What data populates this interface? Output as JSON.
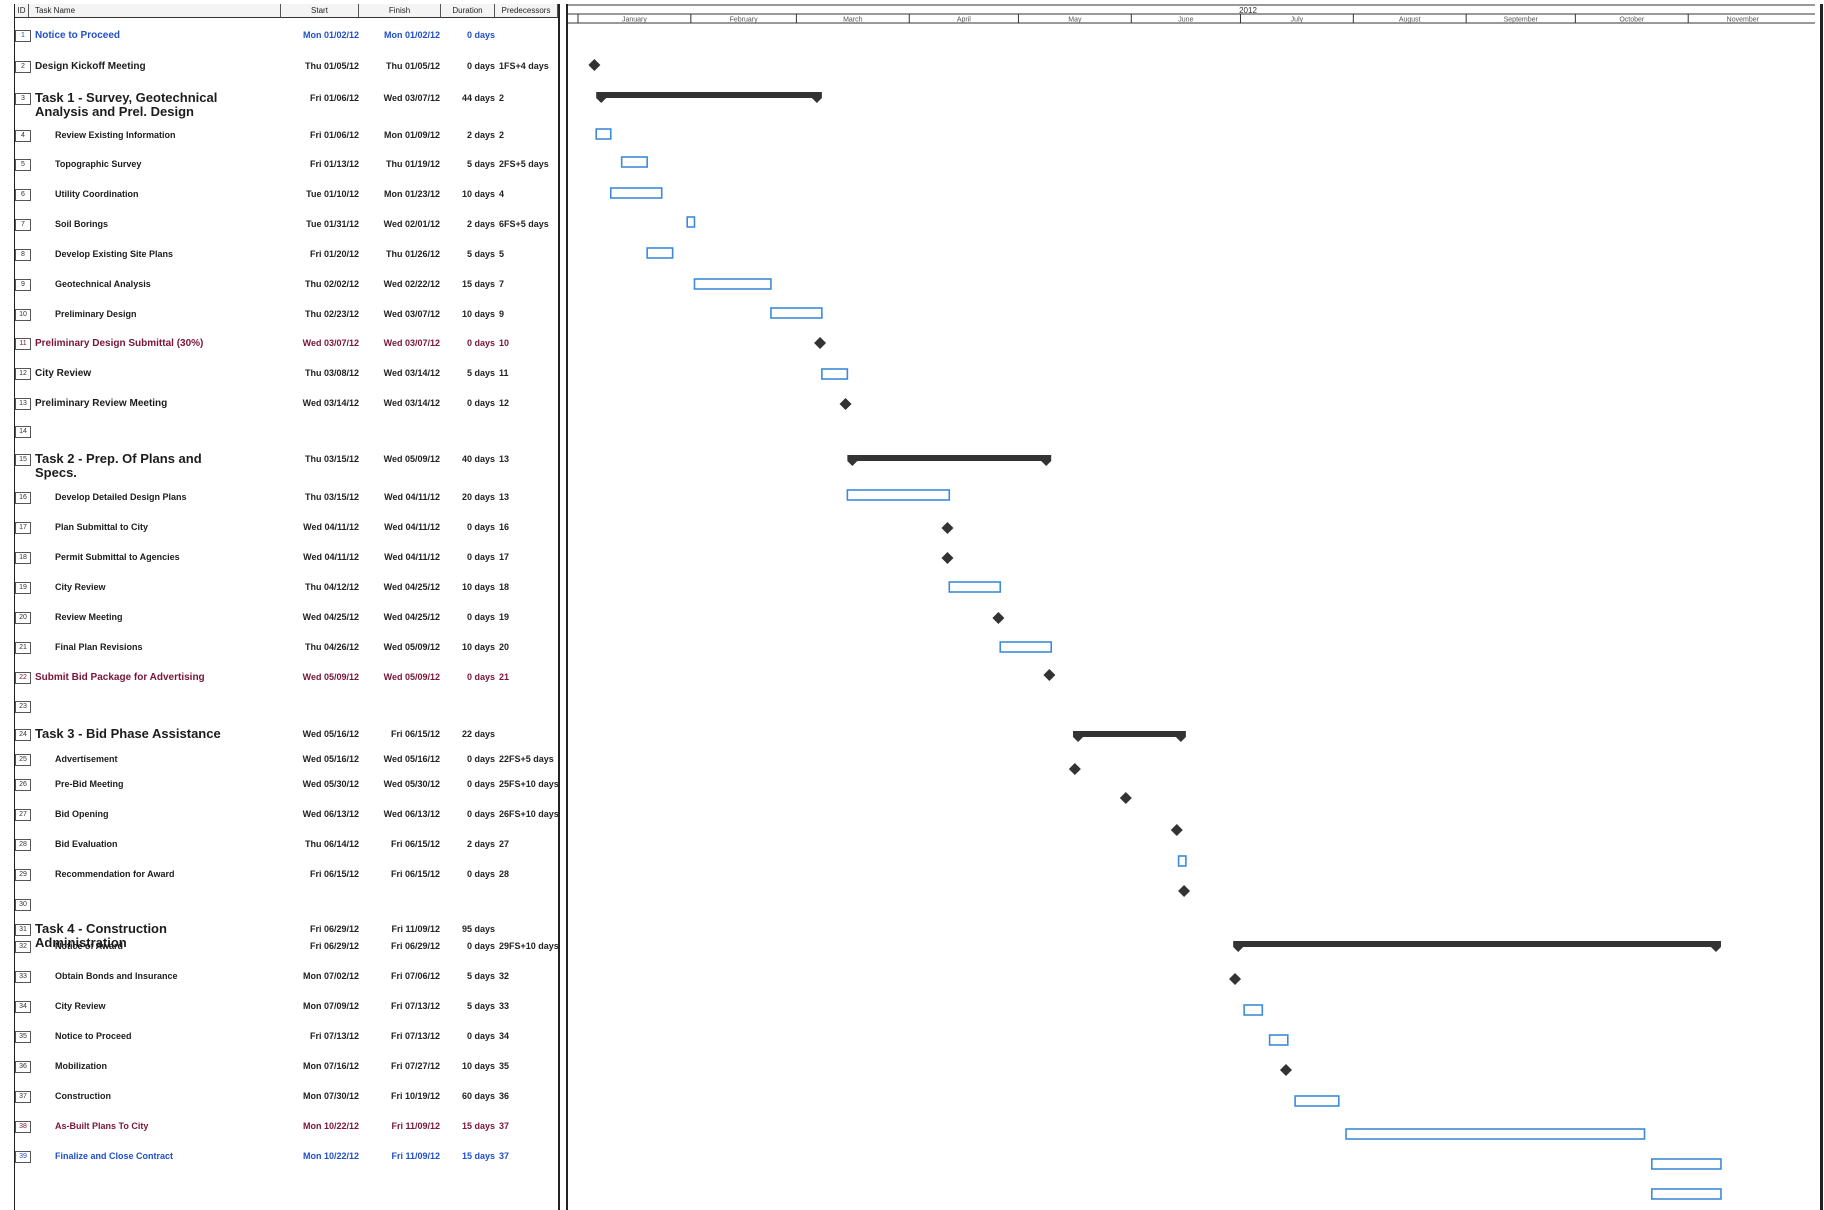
{
  "columns": {
    "id": "ID",
    "name": "Task Name",
    "start": "Start",
    "finish": "Finish",
    "duration": "Duration",
    "predecessors": "Predecessors"
  },
  "timeline": {
    "year": "2012",
    "months": [
      "January",
      "February",
      "March",
      "April",
      "May",
      "June",
      "July",
      "August",
      "September",
      "October",
      "November"
    ]
  },
  "colors": {
    "bar": "#3d8bd8",
    "summary": "#333333",
    "milestone": "#333333",
    "milestone_text": "#1f4fc9",
    "deliverable_text": "#7a1535"
  },
  "tasks": [
    {
      "id": "1",
      "name": "Notice to Proceed",
      "start": "Mon 01/02/12",
      "finish": "Mon 01/02/12",
      "duration": "0 days",
      "pred": "",
      "kind": "top",
      "color": "blue",
      "s": "2012-01-02",
      "f": "2012-01-02",
      "type": "none"
    },
    {
      "id": "2",
      "name": "Design Kickoff Meeting",
      "start": "Thu 01/05/12",
      "finish": "Thu 01/05/12",
      "duration": "0 days",
      "pred": "1FS+4 days",
      "kind": "top",
      "color": "",
      "s": "2012-01-05",
      "f": "2012-01-05",
      "type": "milestone"
    },
    {
      "id": "3",
      "name": "Task 1 - Survey, Geotechnical Analysis and Prel. Design",
      "start": "Fri 01/06/12",
      "finish": "Wed 03/07/12",
      "duration": "44 days",
      "pred": "2",
      "kind": "task",
      "color": "",
      "s": "2012-01-06",
      "f": "2012-03-07",
      "type": "summary"
    },
    {
      "id": "4",
      "name": "Review Existing Information",
      "start": "Fri 01/06/12",
      "finish": "Mon 01/09/12",
      "duration": "2 days",
      "pred": "2",
      "kind": "sub",
      "color": "",
      "s": "2012-01-06",
      "f": "2012-01-09",
      "type": "bar"
    },
    {
      "id": "5",
      "name": "Topographic Survey",
      "start": "Fri 01/13/12",
      "finish": "Thu 01/19/12",
      "duration": "5 days",
      "pred": "2FS+5 days",
      "kind": "sub",
      "color": "",
      "s": "2012-01-13",
      "f": "2012-01-19",
      "type": "bar"
    },
    {
      "id": "6",
      "name": "Utility Coordination",
      "start": "Tue 01/10/12",
      "finish": "Mon 01/23/12",
      "duration": "10 days",
      "pred": "4",
      "kind": "sub",
      "color": "",
      "s": "2012-01-10",
      "f": "2012-01-23",
      "type": "bar"
    },
    {
      "id": "7",
      "name": "Soil Borings",
      "start": "Tue 01/31/12",
      "finish": "Wed 02/01/12",
      "duration": "2 days",
      "pred": "6FS+5 days",
      "kind": "sub",
      "color": "",
      "s": "2012-01-31",
      "f": "2012-02-01",
      "type": "bar"
    },
    {
      "id": "8",
      "name": "Develop Existing Site Plans",
      "start": "Fri 01/20/12",
      "finish": "Thu 01/26/12",
      "duration": "5 days",
      "pred": "5",
      "kind": "sub",
      "color": "",
      "s": "2012-01-20",
      "f": "2012-01-26",
      "type": "bar"
    },
    {
      "id": "9",
      "name": "Geotechnical Analysis",
      "start": "Thu 02/02/12",
      "finish": "Wed 02/22/12",
      "duration": "15 days",
      "pred": "7",
      "kind": "sub",
      "color": "",
      "s": "2012-02-02",
      "f": "2012-02-22",
      "type": "bar"
    },
    {
      "id": "10",
      "name": "Preliminary Design",
      "start": "Thu 02/23/12",
      "finish": "Wed 03/07/12",
      "duration": "10 days",
      "pred": "9",
      "kind": "sub",
      "color": "",
      "s": "2012-02-23",
      "f": "2012-03-07",
      "type": "bar"
    },
    {
      "id": "11",
      "name": "Preliminary Design Submittal (30%)",
      "start": "Wed 03/07/12",
      "finish": "Wed 03/07/12",
      "duration": "0 days",
      "pred": "10",
      "kind": "top",
      "color": "maroon",
      "s": "2012-03-07",
      "f": "2012-03-07",
      "type": "milestone"
    },
    {
      "id": "12",
      "name": "City Review",
      "start": "Thu 03/08/12",
      "finish": "Wed 03/14/12",
      "duration": "5 days",
      "pred": "11",
      "kind": "top",
      "color": "",
      "s": "2012-03-08",
      "f": "2012-03-14",
      "type": "bar"
    },
    {
      "id": "13",
      "name": "Preliminary Review Meeting",
      "start": "Wed 03/14/12",
      "finish": "Wed 03/14/12",
      "duration": "0 days",
      "pred": "12",
      "kind": "top",
      "color": "",
      "s": "2012-03-14",
      "f": "2012-03-14",
      "type": "milestone"
    },
    {
      "id": "14",
      "name": "",
      "start": "",
      "finish": "",
      "duration": "",
      "pred": "",
      "kind": "top",
      "color": "",
      "s": "",
      "f": "",
      "type": "none"
    },
    {
      "id": "15",
      "name": "Task 2 - Prep. Of Plans and Specs.",
      "start": "Thu 03/15/12",
      "finish": "Wed 05/09/12",
      "duration": "40 days",
      "pred": "13",
      "kind": "task",
      "color": "",
      "s": "2012-03-15",
      "f": "2012-05-09",
      "type": "summary"
    },
    {
      "id": "16",
      "name": "Develop Detailed Design Plans",
      "start": "Thu 03/15/12",
      "finish": "Wed 04/11/12",
      "duration": "20 days",
      "pred": "13",
      "kind": "sub",
      "color": "",
      "s": "2012-03-15",
      "f": "2012-04-11",
      "type": "bar"
    },
    {
      "id": "17",
      "name": "Plan Submittal to City",
      "start": "Wed 04/11/12",
      "finish": "Wed 04/11/12",
      "duration": "0 days",
      "pred": "16",
      "kind": "sub",
      "color": "",
      "s": "2012-04-11",
      "f": "2012-04-11",
      "type": "milestone"
    },
    {
      "id": "18",
      "name": "Permit Submittal to Agencies",
      "start": "Wed 04/11/12",
      "finish": "Wed 04/11/12",
      "duration": "0 days",
      "pred": "17",
      "kind": "sub",
      "color": "",
      "s": "2012-04-11",
      "f": "2012-04-11",
      "type": "milestone"
    },
    {
      "id": "19",
      "name": "City Review",
      "start": "Thu 04/12/12",
      "finish": "Wed 04/25/12",
      "duration": "10 days",
      "pred": "18",
      "kind": "sub",
      "color": "",
      "s": "2012-04-12",
      "f": "2012-04-25",
      "type": "bar"
    },
    {
      "id": "20",
      "name": "Review Meeting",
      "start": "Wed 04/25/12",
      "finish": "Wed 04/25/12",
      "duration": "0 days",
      "pred": "19",
      "kind": "sub",
      "color": "",
      "s": "2012-04-25",
      "f": "2012-04-25",
      "type": "milestone"
    },
    {
      "id": "21",
      "name": "Final Plan Revisions",
      "start": "Thu 04/26/12",
      "finish": "Wed 05/09/12",
      "duration": "10 days",
      "pred": "20",
      "kind": "sub",
      "color": "",
      "s": "2012-04-26",
      "f": "2012-05-09",
      "type": "bar"
    },
    {
      "id": "22",
      "name": "Submit Bid Package for Advertising",
      "start": "Wed 05/09/12",
      "finish": "Wed 05/09/12",
      "duration": "0 days",
      "pred": "21",
      "kind": "top",
      "color": "maroon",
      "s": "2012-05-09",
      "f": "2012-05-09",
      "type": "milestone"
    },
    {
      "id": "23",
      "name": "",
      "start": "",
      "finish": "",
      "duration": "",
      "pred": "",
      "kind": "top",
      "color": "",
      "s": "",
      "f": "",
      "type": "none"
    },
    {
      "id": "24",
      "name": "Task 3 - Bid Phase Assistance",
      "start": "Wed 05/16/12",
      "finish": "Fri 06/15/12",
      "duration": "22 days",
      "pred": "",
      "kind": "task",
      "color": "",
      "s": "2012-05-16",
      "f": "2012-06-15",
      "type": "summary"
    },
    {
      "id": "25",
      "name": "Advertisement",
      "start": "Wed 05/16/12",
      "finish": "Wed 05/16/12",
      "duration": "0 days",
      "pred": "22FS+5 days",
      "kind": "sub",
      "color": "",
      "s": "2012-05-16",
      "f": "2012-05-16",
      "type": "milestone"
    },
    {
      "id": "26",
      "name": "Pre-Bid Meeting",
      "start": "Wed 05/30/12",
      "finish": "Wed 05/30/12",
      "duration": "0 days",
      "pred": "25FS+10 days",
      "kind": "sub",
      "color": "",
      "s": "2012-05-30",
      "f": "2012-05-30",
      "type": "milestone"
    },
    {
      "id": "27",
      "name": "Bid Opening",
      "start": "Wed 06/13/12",
      "finish": "Wed 06/13/12",
      "duration": "0 days",
      "pred": "26FS+10 days",
      "kind": "sub",
      "color": "",
      "s": "2012-06-13",
      "f": "2012-06-13",
      "type": "milestone"
    },
    {
      "id": "28",
      "name": "Bid Evaluation",
      "start": "Thu 06/14/12",
      "finish": "Fri 06/15/12",
      "duration": "2 days",
      "pred": "27",
      "kind": "sub",
      "color": "",
      "s": "2012-06-14",
      "f": "2012-06-15",
      "type": "bar"
    },
    {
      "id": "29",
      "name": "Recommendation for Award",
      "start": "Fri 06/15/12",
      "finish": "Fri 06/15/12",
      "duration": "0 days",
      "pred": "28",
      "kind": "sub",
      "color": "",
      "s": "2012-06-15",
      "f": "2012-06-15",
      "type": "milestone"
    },
    {
      "id": "30",
      "name": "",
      "start": "",
      "finish": "",
      "duration": "",
      "pred": "",
      "kind": "top",
      "color": "",
      "s": "",
      "f": "",
      "type": "none"
    },
    {
      "id": "31",
      "name": "Task 4 - Construction Administration",
      "start": "Fri 06/29/12",
      "finish": "Fri 11/09/12",
      "duration": "95 days",
      "pred": "",
      "kind": "task",
      "color": "",
      "s": "2012-06-29",
      "f": "2012-11-09",
      "type": "summary"
    },
    {
      "id": "32",
      "name": "Notice of Award",
      "start": "Fri 06/29/12",
      "finish": "Fri 06/29/12",
      "duration": "0 days",
      "pred": "29FS+10 days",
      "kind": "sub",
      "color": "",
      "s": "2012-06-29",
      "f": "2012-06-29",
      "type": "milestone"
    },
    {
      "id": "33",
      "name": "Obtain Bonds and Insurance",
      "start": "Mon 07/02/12",
      "finish": "Fri 07/06/12",
      "duration": "5 days",
      "pred": "32",
      "kind": "sub",
      "color": "",
      "s": "2012-07-02",
      "f": "2012-07-06",
      "type": "bar"
    },
    {
      "id": "34",
      "name": "City Review",
      "start": "Mon 07/09/12",
      "finish": "Fri 07/13/12",
      "duration": "5 days",
      "pred": "33",
      "kind": "sub",
      "color": "",
      "s": "2012-07-09",
      "f": "2012-07-13",
      "type": "bar"
    },
    {
      "id": "35",
      "name": "Notice to Proceed",
      "start": "Fri 07/13/12",
      "finish": "Fri 07/13/12",
      "duration": "0 days",
      "pred": "34",
      "kind": "sub",
      "color": "",
      "s": "2012-07-13",
      "f": "2012-07-13",
      "type": "milestone"
    },
    {
      "id": "36",
      "name": "Mobilization",
      "start": "Mon 07/16/12",
      "finish": "Fri 07/27/12",
      "duration": "10 days",
      "pred": "35",
      "kind": "sub",
      "color": "",
      "s": "2012-07-16",
      "f": "2012-07-27",
      "type": "bar"
    },
    {
      "id": "37",
      "name": "Construction",
      "start": "Mon 07/30/12",
      "finish": "Fri 10/19/12",
      "duration": "60 days",
      "pred": "36",
      "kind": "sub",
      "color": "",
      "s": "2012-07-30",
      "f": "2012-10-19",
      "type": "bar"
    },
    {
      "id": "38",
      "name": "As-Built Plans To City",
      "start": "Mon 10/22/12",
      "finish": "Fri 11/09/12",
      "duration": "15 days",
      "pred": "37",
      "kind": "sub",
      "color": "maroon",
      "s": "2012-10-22",
      "f": "2012-11-09",
      "type": "bar"
    },
    {
      "id": "39",
      "name": "Finalize and Close Contract",
      "start": "Mon 10/22/12",
      "finish": "Fri 11/09/12",
      "duration": "15 days",
      "pred": "37",
      "kind": "sub",
      "color": "blue",
      "s": "2012-10-22",
      "f": "2012-11-09",
      "type": "bar"
    }
  ]
}
